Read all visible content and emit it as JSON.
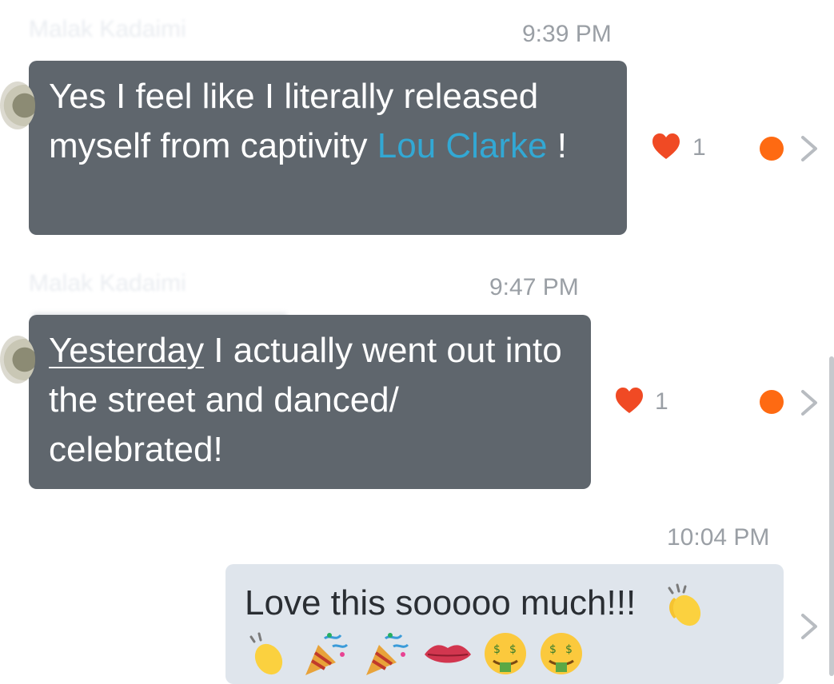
{
  "messages": [
    {
      "sender": "Malak Kadaimi",
      "time": "9:39 PM",
      "text_before": "Yes I feel like I literally released myself from captivity ",
      "mention": "Lou Clarke",
      "text_after": " !",
      "likes": "1"
    },
    {
      "sender": "Malak Kadaimi",
      "time": "9:47 PM",
      "underlined": "Yesterday",
      "text": " I actually went out into the street and danced/ celebrated!",
      "likes": "1"
    }
  ],
  "my_message": {
    "time": "10:04 PM",
    "text": "Love this sooooo much!!!",
    "emojis": [
      "clapping-hands",
      "clapping-hands",
      "party-popper",
      "party-popper",
      "lips",
      "money-mouth-face",
      "money-mouth-face"
    ]
  },
  "colors": {
    "incoming_bubble": "#5f666d",
    "outgoing_bubble": "#dfe5ec",
    "mention": "#32a8d4",
    "heart": "#f04a24",
    "unread_dot": "#fe6a12"
  },
  "icons": [
    "heart-icon",
    "chevron-right-icon",
    "unread-dot-icon"
  ]
}
